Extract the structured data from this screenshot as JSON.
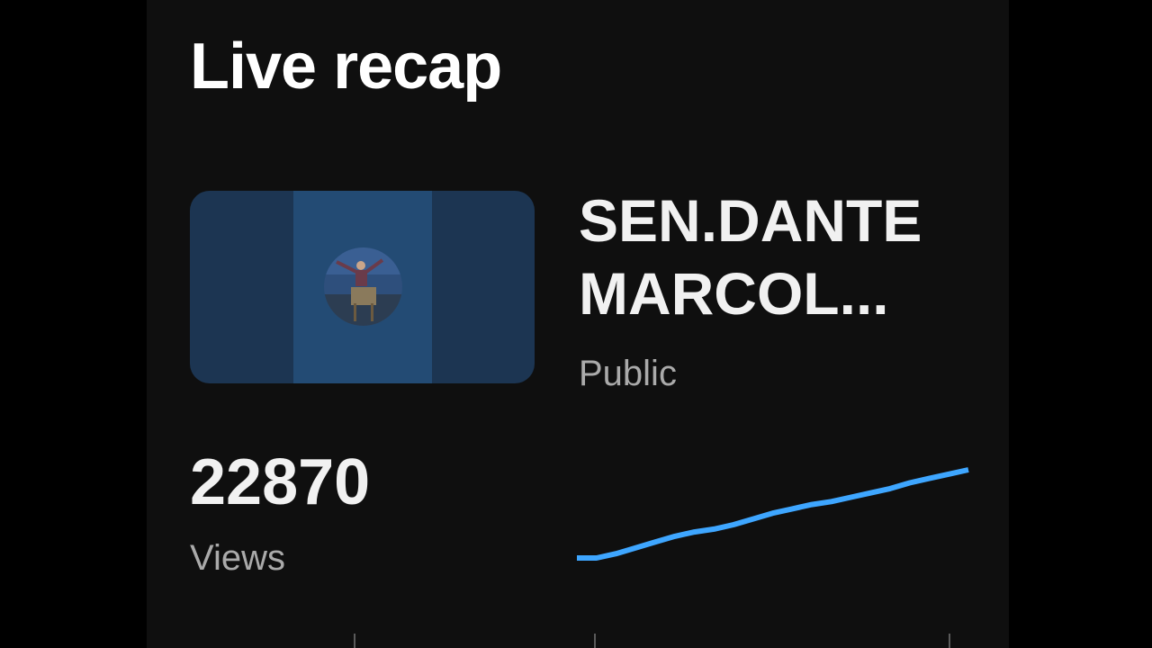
{
  "header": {
    "title": "Live recap"
  },
  "video": {
    "title_line1": "SEN.DANTE",
    "title_line2": "MARCOL...",
    "visibility": "Public",
    "thumbnail_side_color": "#1c3552",
    "thumbnail_center_color": "#234b74"
  },
  "stats": {
    "views_count": "22870",
    "views_label": "Views"
  },
  "chart_data": {
    "type": "line",
    "title": "",
    "xlabel": "",
    "ylabel": "",
    "color": "#3ea6ff",
    "grid": false,
    "series": [
      {
        "values": [
          0,
          0,
          3,
          7,
          11,
          15,
          18,
          20,
          23,
          27,
          31,
          34,
          37,
          39,
          42,
          45,
          48,
          52,
          55,
          58,
          61
        ]
      }
    ]
  },
  "colors": {
    "background": "#000000",
    "panel": "#0f0f0f",
    "primary_text": "#f1f1f1",
    "secondary_text": "#aaaaaa",
    "accent": "#3ea6ff"
  }
}
